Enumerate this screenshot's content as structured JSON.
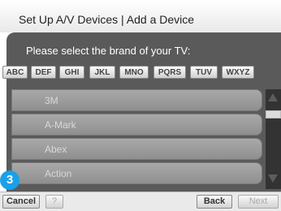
{
  "window": {
    "title": "Set Up A/V Devices | Add a Device"
  },
  "prompt": "Please select the brand of your TV:",
  "tabs": [
    "ABC",
    "DEF",
    "GHI",
    "JKL",
    "MNO",
    "PQRS",
    "TUV",
    "WXYZ"
  ],
  "brands": [
    "3M",
    "A-Mark",
    "Abex",
    "Action"
  ],
  "step_badge": "3",
  "buttons": {
    "cancel": "Cancel",
    "help": "?",
    "back": "Back",
    "next": "Next"
  }
}
